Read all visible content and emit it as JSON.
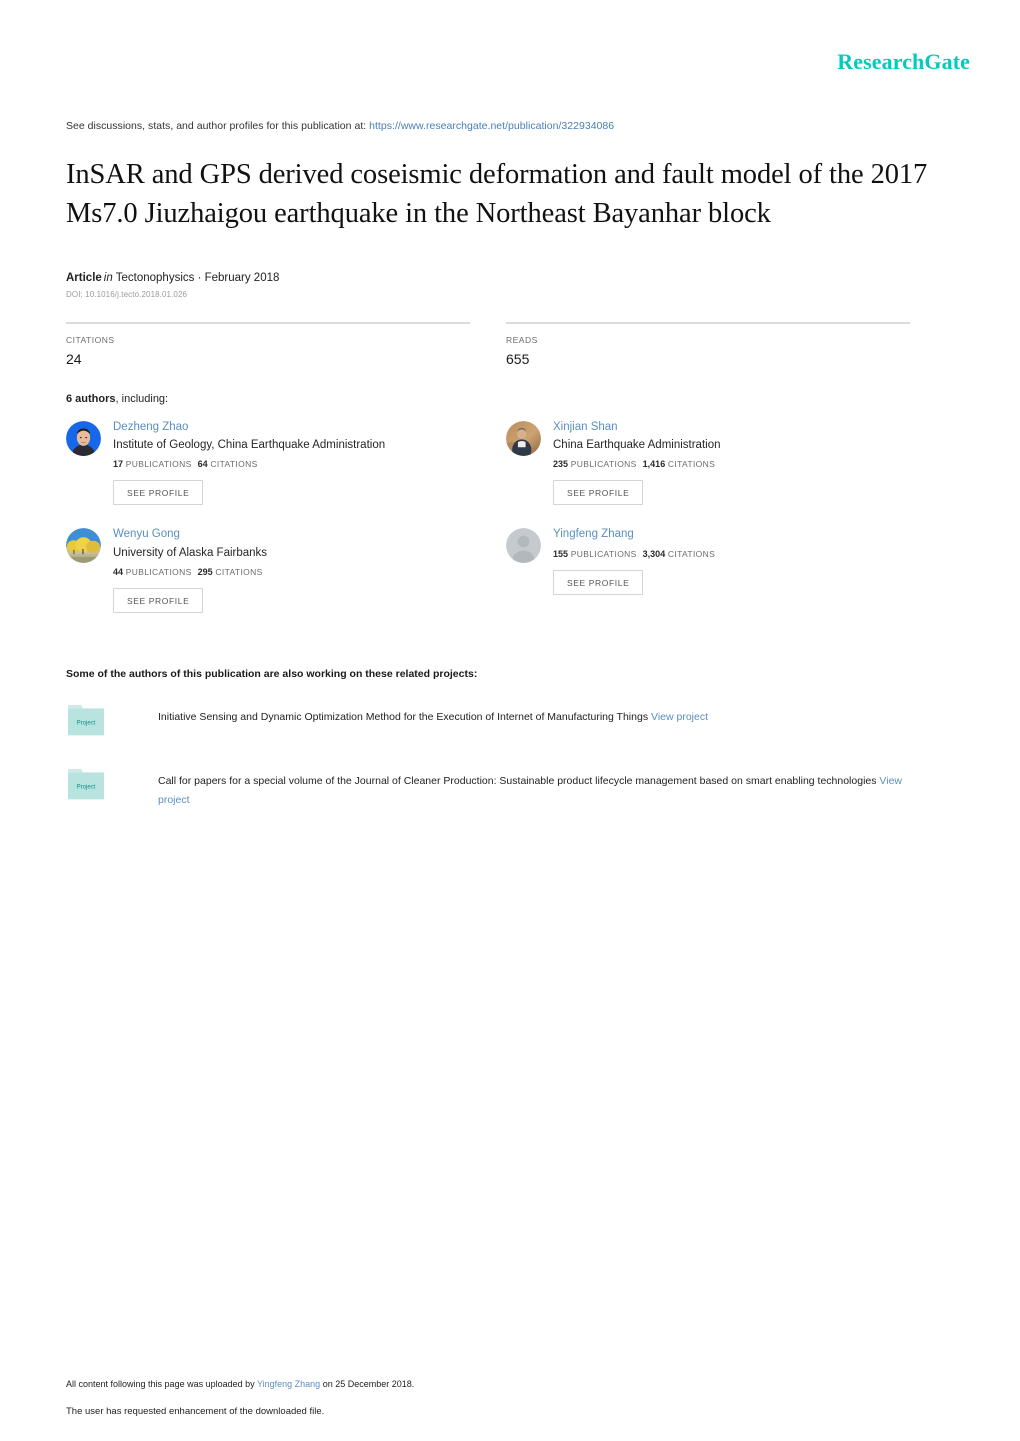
{
  "header": {
    "logo_text": "ResearchGate",
    "logo_color": "#00ccbb"
  },
  "discussion": {
    "prefix": "See discussions, stats, and author profiles for this publication at:",
    "url": "https://www.researchgate.net/publication/322934086"
  },
  "publication": {
    "title": "InSAR and GPS derived coseismic deformation and fault model of the 2017 Ms7.0 Jiuzhaigou earthquake in the Northeast Bayanhar block",
    "type": "Article",
    "in_word": "in",
    "journal_and_date": "Tectonophysics · February 2018",
    "doi": "DOI: 10.1016/j.tecto.2018.01.026"
  },
  "stats": {
    "citations_label": "CITATIONS",
    "citations_value": "24",
    "reads_label": "READS",
    "reads_value": "655"
  },
  "authors_section": {
    "count_text": "6 authors",
    "including_text": ", including:",
    "see_profile_label": "SEE PROFILE",
    "publications_label": "PUBLICATIONS",
    "citations_label": "CITATIONS",
    "authors": [
      {
        "name": "Dezheng Zhao",
        "institution": "Institute of Geology, China Earthquake Administration",
        "publications": "17",
        "citations": "64",
        "avatar_type": "photo-person-blue"
      },
      {
        "name": "Xinjian Shan",
        "institution": "China Earthquake Administration",
        "publications": "235",
        "citations": "1,416",
        "avatar_type": "photo-person-tan"
      },
      {
        "name": "Wenyu Gong",
        "institution": "University of Alaska Fairbanks",
        "publications": "44",
        "citations": "295",
        "avatar_type": "photo-landscape"
      },
      {
        "name": "Yingfeng Zhang",
        "institution": "",
        "publications": "155",
        "citations": "3,304",
        "avatar_type": "placeholder-silhouette"
      }
    ]
  },
  "projects_section": {
    "heading": "Some of the authors of this publication are also working on these related projects:",
    "folder_label": "Project",
    "view_link_text": "View project",
    "projects": [
      {
        "title": "Initiative Sensing and Dynamic Optimization Method for the Execution of Internet of Manufacturing Things"
      },
      {
        "title": "Call for papers for a special volume of the Journal of Cleaner Production: Sustainable product lifecycle management based on smart enabling technologies"
      }
    ]
  },
  "footer": {
    "line1_prefix": "All content following this page was uploaded by",
    "line1_uploader": "Yingfeng Zhang",
    "line1_suffix": "on 25 December 2018.",
    "line2": "The user has requested enhancement of the downloaded file."
  }
}
